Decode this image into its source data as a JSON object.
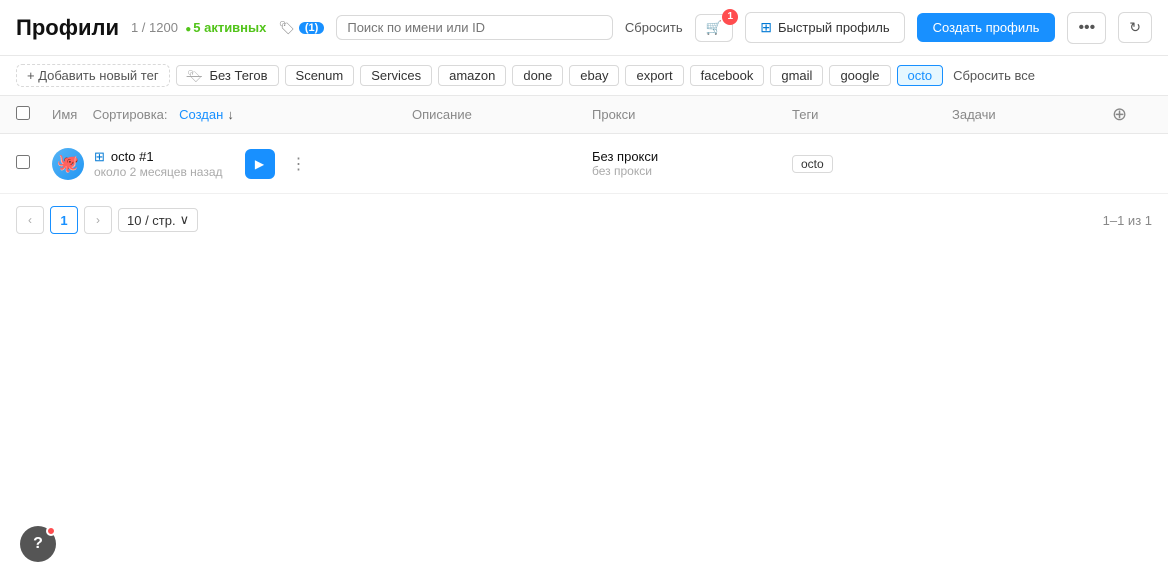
{
  "header": {
    "title": "Профили",
    "count_text": "1 / 1200",
    "active_label": "5 активных",
    "tag_icon_label": "(1)",
    "search_placeholder": "Поиск по имени или ID",
    "reset_label": "Сбросить",
    "filter_badge": "1",
    "quick_profile_label": "Быстрый профиль",
    "create_profile_label": "Создать профиль",
    "more_icon": "•••",
    "refresh_icon": "↻"
  },
  "tags_bar": {
    "add_tag_label": "+ Добавить новый тег",
    "tags": [
      {
        "label": "Без Тегов",
        "type": "no-tags"
      },
      {
        "label": "Scenum",
        "type": "normal"
      },
      {
        "label": "Services",
        "type": "normal"
      },
      {
        "label": "amazon",
        "type": "normal"
      },
      {
        "label": "done",
        "type": "normal"
      },
      {
        "label": "ebay",
        "type": "normal"
      },
      {
        "label": "export",
        "type": "normal"
      },
      {
        "label": "facebook",
        "type": "normal"
      },
      {
        "label": "gmail",
        "type": "normal"
      },
      {
        "label": "google",
        "type": "normal"
      },
      {
        "label": "octo",
        "type": "active"
      }
    ],
    "reset_all_label": "Сбросить все"
  },
  "table": {
    "columns": {
      "name": "Имя",
      "sort_prefix": "Сортировка:",
      "sort_label": "Создан",
      "description": "Описание",
      "proxy": "Прокси",
      "tags": "Теги",
      "tasks": "Задачи"
    },
    "rows": [
      {
        "id": "octo-1",
        "name": "octo #1",
        "time": "около 2 месяцев назад",
        "description": "",
        "proxy_main": "Без прокси",
        "proxy_sub": "без прокси",
        "tag": "octo"
      }
    ]
  },
  "pagination": {
    "prev_icon": "‹",
    "current_page": "1",
    "next_icon": "›",
    "per_page": "10 / стр.",
    "per_page_arrow": "∨",
    "summary": "1–1 из 1"
  },
  "help": {
    "icon": "?"
  }
}
